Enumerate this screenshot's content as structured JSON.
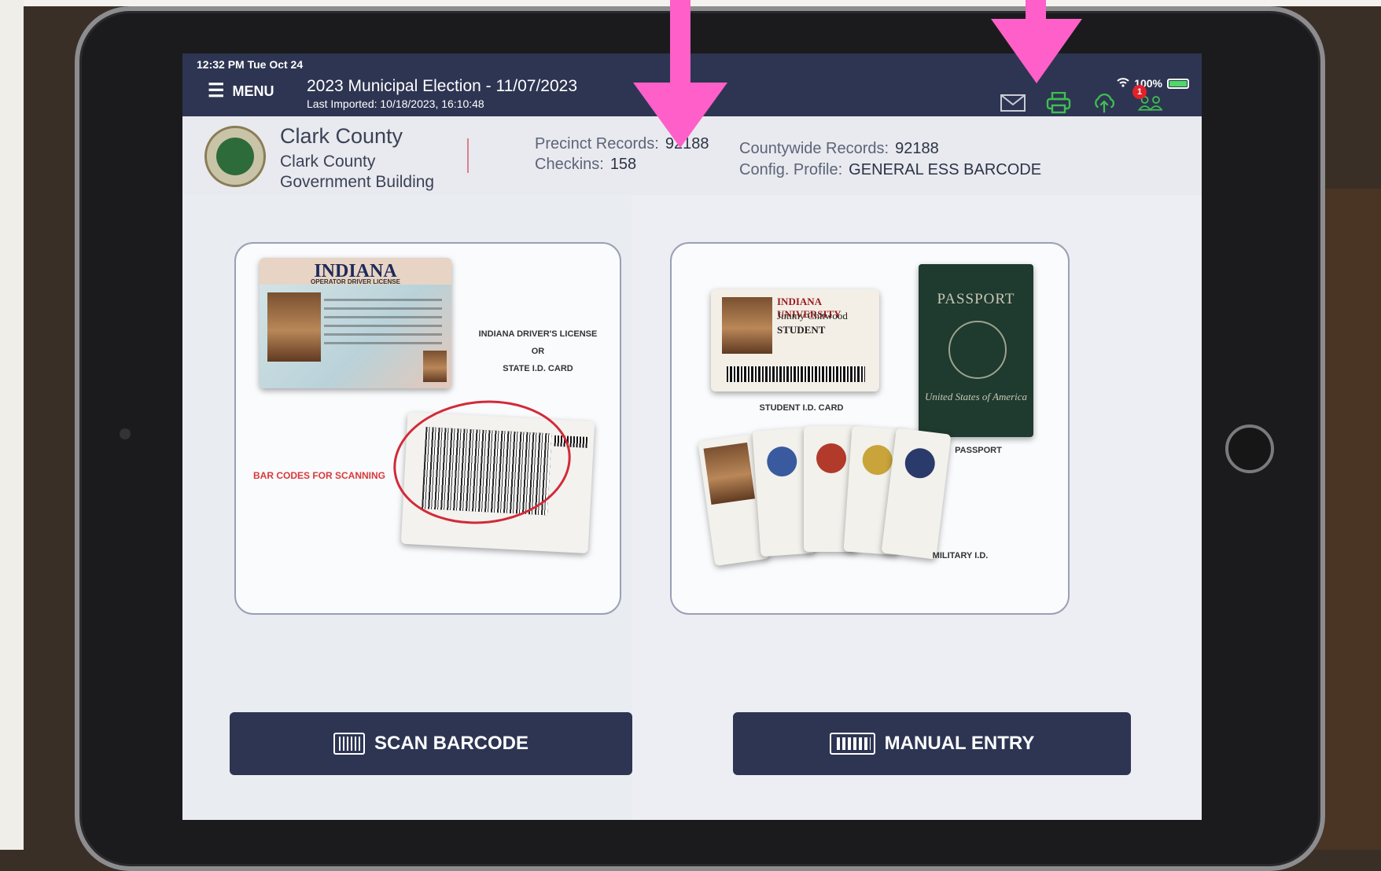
{
  "status_bar": {
    "time": "12:32 PM  Tue Oct 24",
    "battery": "100%"
  },
  "header": {
    "menu_label": "MENU",
    "election_title": "2023 Municipal Election  - 11/07/2023",
    "last_imported": "Last Imported: 10/18/2023, 16:10:48",
    "icons": [
      "mail-icon",
      "printer-icon",
      "cloud-upload-icon",
      "users-icon"
    ],
    "users_badge": "1"
  },
  "location": {
    "county": "Clark County",
    "line2": "Clark County",
    "line3": "Government Building"
  },
  "stats": {
    "precinct_label": "Precinct Records:",
    "precinct_value": "92188",
    "checkins_label": "Checkins:",
    "checkins_value": "158",
    "countywide_label": "Countywide Records:",
    "countywide_value": "92188",
    "config_label": "Config. Profile:",
    "config_value": "GENERAL ESS BARCODE"
  },
  "left_card": {
    "license_state": "INDIANA",
    "license_type": "OPERATOR DRIVER LICENSE",
    "caption_1": "INDIANA DRIVER'S LICENSE",
    "caption_or": "OR",
    "caption_2": "STATE I.D. CARD",
    "barcode_note": "BAR CODES FOR SCANNING"
  },
  "right_card": {
    "student_uni": "INDIANA UNIVERSITY",
    "student_name": "Jimmy Chitwood",
    "student_role": "STUDENT",
    "student_caption": "STUDENT I.D. CARD",
    "passport_title": "PASSPORT",
    "passport_country": "United States of America",
    "passport_caption": "PASSPORT",
    "military_caption": "MILITARY I.D."
  },
  "buttons": {
    "scan": "SCAN BARCODE",
    "manual": "MANUAL ENTRY"
  },
  "colors": {
    "header_bg": "#2e3552",
    "annotation_arrow": "#ff5fc8",
    "accent_green": "#3fbf52",
    "badge_red": "#e2212d"
  }
}
